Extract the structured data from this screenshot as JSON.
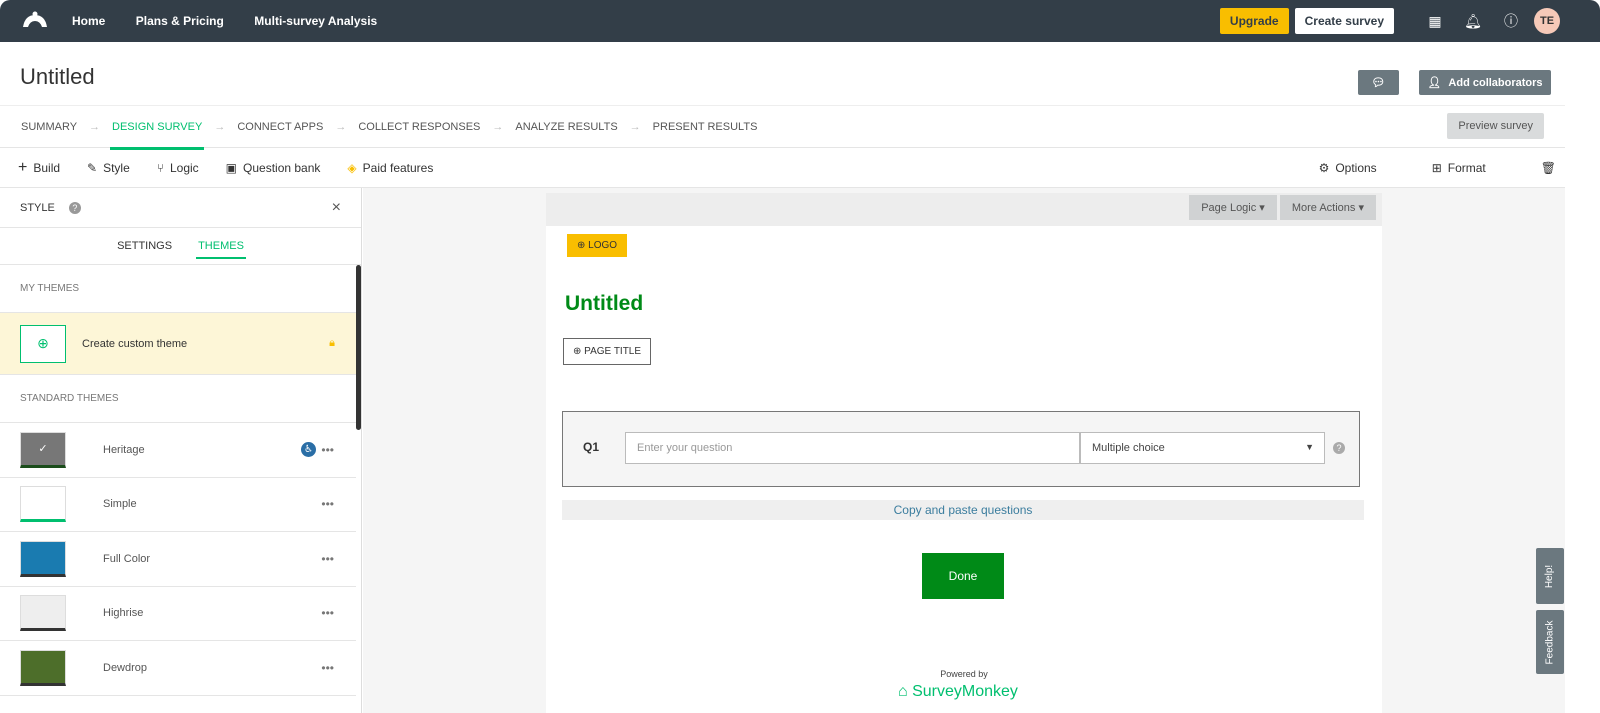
{
  "nav": {
    "items": [
      "Home",
      "Plans & Pricing",
      "Multi-survey Analysis"
    ],
    "upgrade": "Upgrade",
    "create_survey": "Create survey",
    "avatar": "TE"
  },
  "header": {
    "title": "Untitled",
    "add_collaborators": "Add collaborators"
  },
  "steps": [
    "SUMMARY",
    "DESIGN SURVEY",
    "CONNECT APPS",
    "COLLECT RESPONSES",
    "ANALYZE RESULTS",
    "PRESENT RESULTS"
  ],
  "preview": "Preview survey",
  "tools": {
    "left": [
      "Build",
      "Style",
      "Logic",
      "Question bank",
      "Paid features"
    ],
    "options": "Options",
    "format": "Format"
  },
  "sidebar": {
    "title": "STYLE",
    "tabs": [
      "SETTINGS",
      "THEMES"
    ],
    "my_themes": "MY THEMES",
    "create_custom": "Create custom theme",
    "standard": "STANDARD THEMES",
    "themes": [
      {
        "name": "Heritage",
        "color": "#777777"
      },
      {
        "name": "Simple",
        "color": "#ffffff"
      },
      {
        "name": "Full Color",
        "color": "#1a7bb0"
      },
      {
        "name": "Highrise",
        "color": "#eeeeee"
      },
      {
        "name": "Dewdrop",
        "color": "#4d6e2a"
      }
    ]
  },
  "page": {
    "page_logic": "Page Logic",
    "more_actions": "More Actions",
    "logo": "LOGO",
    "title": "Untitled",
    "page_title": "PAGE TITLE",
    "q_label": "Q1",
    "q_placeholder": "Enter your question",
    "q_type": "Multiple choice",
    "copy_paste": "Copy and paste questions",
    "done": "Done",
    "powered": "Powered by",
    "brand": "SurveyMonkey"
  },
  "side_tabs": {
    "help": "Help!",
    "feedback": "Feedback"
  },
  "colors": {
    "accent": "#00bf6f",
    "brand_green": "#008a17",
    "upgrade": "#f9be00",
    "topbar": "#333e48"
  }
}
